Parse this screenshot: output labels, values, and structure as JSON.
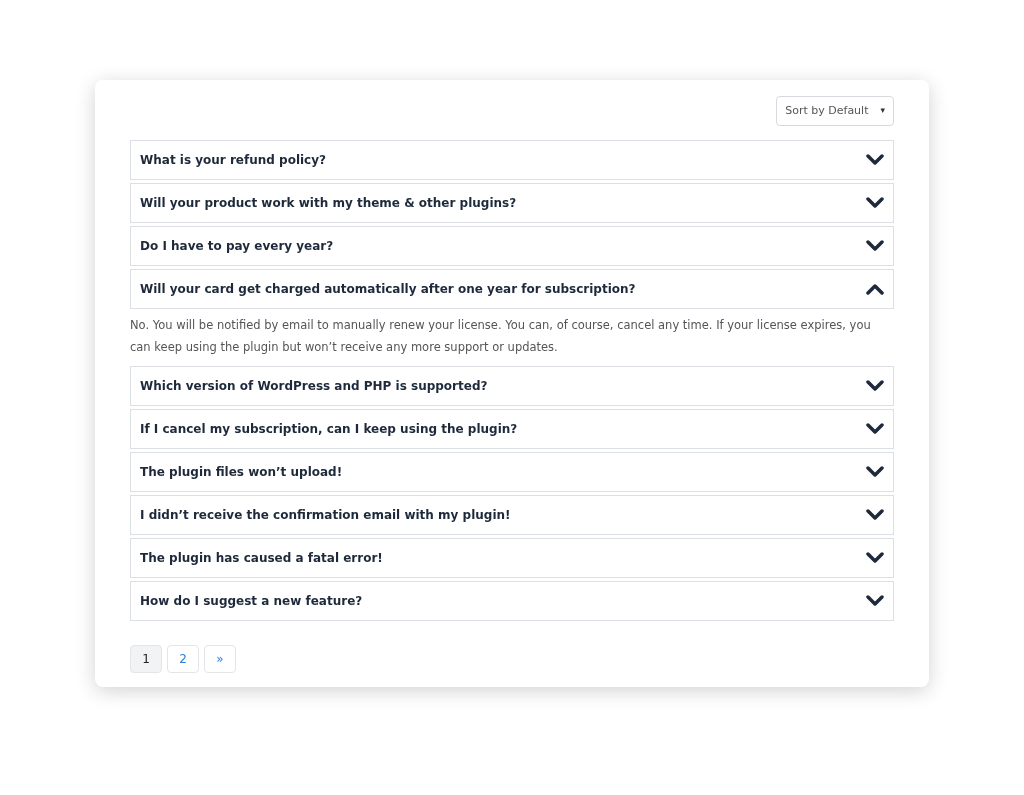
{
  "sort": {
    "value": "Sort by Default",
    "caret": "▾"
  },
  "faq": [
    {
      "question": "What is your refund policy?",
      "expanded": false
    },
    {
      "question": "Will your product work with my theme & other plugins?",
      "expanded": false
    },
    {
      "question": "Do I have to pay every year?",
      "expanded": false
    },
    {
      "question": "Will your card get charged automatically after one year for subscription?",
      "expanded": true,
      "answer": "No. You will be notified by email to manually renew your license. You can, of course, cancel any time. If your license expires, you can keep using the plugin but won’t receive any more support or updates."
    },
    {
      "question": "Which version of WordPress and PHP is supported?",
      "expanded": false
    },
    {
      "question": "If I cancel my subscription, can I keep using the plugin?",
      "expanded": false
    },
    {
      "question": "The plugin files won’t upload!",
      "expanded": false
    },
    {
      "question": "I didn’t receive the confirmation email with my plugin!",
      "expanded": false
    },
    {
      "question": "The plugin has caused a fatal error!",
      "expanded": false
    },
    {
      "question": "How do I suggest a new feature?",
      "expanded": false
    }
  ],
  "pagination": [
    {
      "label": "1",
      "selected": true
    },
    {
      "label": "2",
      "selected": false
    },
    {
      "label": "»",
      "selected": false
    }
  ]
}
